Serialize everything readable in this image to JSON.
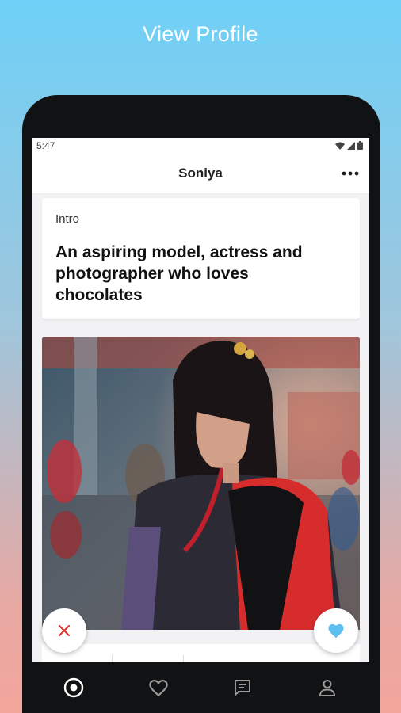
{
  "promo": {
    "title": "View Profile"
  },
  "status_bar": {
    "time": "5:47"
  },
  "app_bar": {
    "title": "Soniya"
  },
  "intro_card": {
    "label": "Intro",
    "text": "An aspiring model, actress and photographer who loves chocolates"
  },
  "icons": {
    "more": "more-horizontal-icon",
    "dislike": "close-icon",
    "like": "heart-icon",
    "nav": [
      "discover-icon",
      "heart-outline-icon",
      "chat-icon",
      "person-icon"
    ]
  },
  "colors": {
    "dislike": "#e53935",
    "like": "#5bc0f0",
    "nav_active": "#ffffff",
    "nav_inactive": "#9a9a9a"
  }
}
